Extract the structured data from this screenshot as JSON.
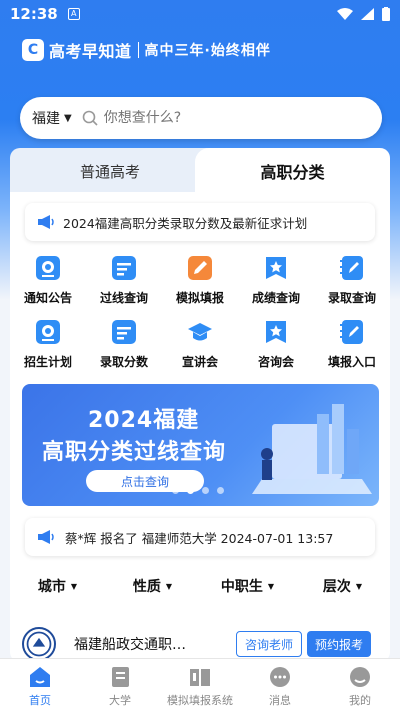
{
  "status_bar": {
    "time": "12:38",
    "notif_badge": "A"
  },
  "brand": {
    "name": "高考早知道",
    "slogan": "高中三年·始终相伴"
  },
  "search": {
    "province": "福建",
    "placeholder": "你想查什么?"
  },
  "tabs": [
    {
      "label": "普通高考",
      "active": false
    },
    {
      "label": "高职分类",
      "active": true
    }
  ],
  "notice": {
    "text": "2024福建高职分类录取分数及最新征求计划"
  },
  "features": [
    {
      "label": "通知公告",
      "icon": "notice-icon"
    },
    {
      "label": "过线查询",
      "icon": "document-icon"
    },
    {
      "label": "模拟填报",
      "icon": "edit-icon"
    },
    {
      "label": "成绩查询",
      "icon": "star-bookmark-icon"
    },
    {
      "label": "录取查询",
      "icon": "notebook-icon"
    },
    {
      "label": "招生计划",
      "icon": "notice-icon"
    },
    {
      "label": "录取分数",
      "icon": "document-icon"
    },
    {
      "label": "宣讲会",
      "icon": "graduation-cap-icon"
    },
    {
      "label": "咨询会",
      "icon": "star-bookmark-icon"
    },
    {
      "label": "填报入口",
      "icon": "notebook-icon"
    }
  ],
  "banner": {
    "line1": "2024福建",
    "line2": "高职分类过线查询",
    "button": "点击查询",
    "slide_index": 1,
    "slide_count": 4
  },
  "feed": {
    "text": "蔡*辉 报名了 福建师范大学 2024-07-01 13:57"
  },
  "filters": [
    "城市",
    "性质",
    "中职生",
    "层次"
  ],
  "school": {
    "name": "福建船政交通职…",
    "consult_label": "咨询老师",
    "apply_label": "预约报考"
  },
  "bottom_nav": [
    {
      "label": "首页",
      "icon": "home-icon",
      "active": true
    },
    {
      "label": "大学",
      "icon": "book-icon",
      "active": false
    },
    {
      "label": "模拟填报系统",
      "icon": "book-open-icon",
      "active": false
    },
    {
      "label": "消息",
      "icon": "chat-icon",
      "active": false
    },
    {
      "label": "我的",
      "icon": "profile-icon",
      "active": false
    }
  ],
  "colors": {
    "primary": "#2f7df0",
    "icon_blue": "#2f8df5",
    "icon_orange": "#f5883a"
  }
}
